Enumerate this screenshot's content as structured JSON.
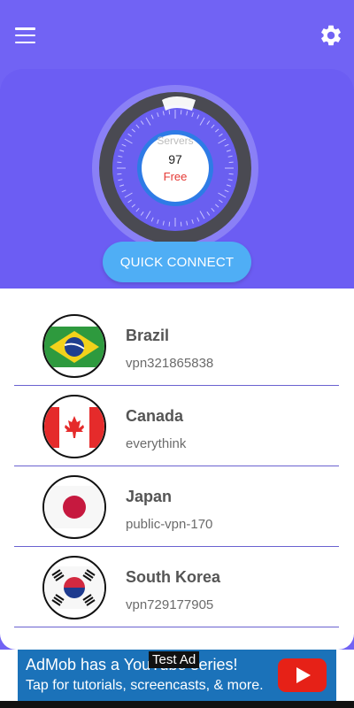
{
  "colors": {
    "header": "#7163f4",
    "accent": "#4faef5",
    "divider": "#6a62d0",
    "free_text": "#e53935"
  },
  "icons": {
    "menu": "hamburger-menu-icon",
    "settings": "gear-icon",
    "ad_play": "youtube-play-icon"
  },
  "dial": {
    "label": "Servers",
    "count": "97",
    "status": "Free"
  },
  "quick_connect_label": "QUICK CONNECT",
  "servers": [
    {
      "country": "Brazil",
      "host": "vpn321865838",
      "flag": "brazil-flag-icon"
    },
    {
      "country": "Canada",
      "host": "everythink",
      "flag": "canada-flag-icon"
    },
    {
      "country": "Japan",
      "host": "public-vpn-170",
      "flag": "japan-flag-icon"
    },
    {
      "country": "South Korea",
      "host": "vpn729177905",
      "flag": "south-korea-flag-icon"
    }
  ],
  "ad": {
    "badge": "Test Ad",
    "line1": "AdMob has a YouTube series!",
    "line2": "Tap for tutorials, screencasts, & more."
  }
}
